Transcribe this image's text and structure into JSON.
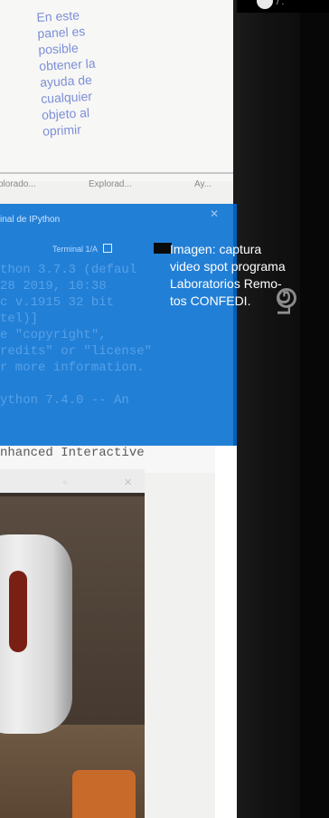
{
  "help_panel": {
    "text_lines": [
      "En este",
      "panel es",
      "posible",
      "obtener la",
      "ayuda de",
      "cualquier",
      "objeto al",
      "oprimir"
    ],
    "tabs": [
      "plorado...",
      "Explorad...",
      "Ay..."
    ]
  },
  "console_panel": {
    "title": "inal de IPython",
    "tab_label": "Terminal 1/A",
    "code_lines": [
      "thon 3.7.3 (defaul",
      "  28 2019, 10:38 ",
      "c v.1915 32 bit",
      "tel)]",
      "e \"copyright\",",
      "redits\" or \"license\"",
      "r more information.",
      "",
      "ython 7.4.0 -- An",
      "nhanced Interactive"
    ]
  },
  "bezel": {
    "brand": "LG"
  },
  "caption": {
    "lines": [
      "Imagen: captura",
      "video spot programa",
      "Laboratorios Remo-",
      "tos CONFEDI."
    ]
  },
  "colors": {
    "overlay": "#006cd2",
    "help_text": "#7d8fd8"
  }
}
